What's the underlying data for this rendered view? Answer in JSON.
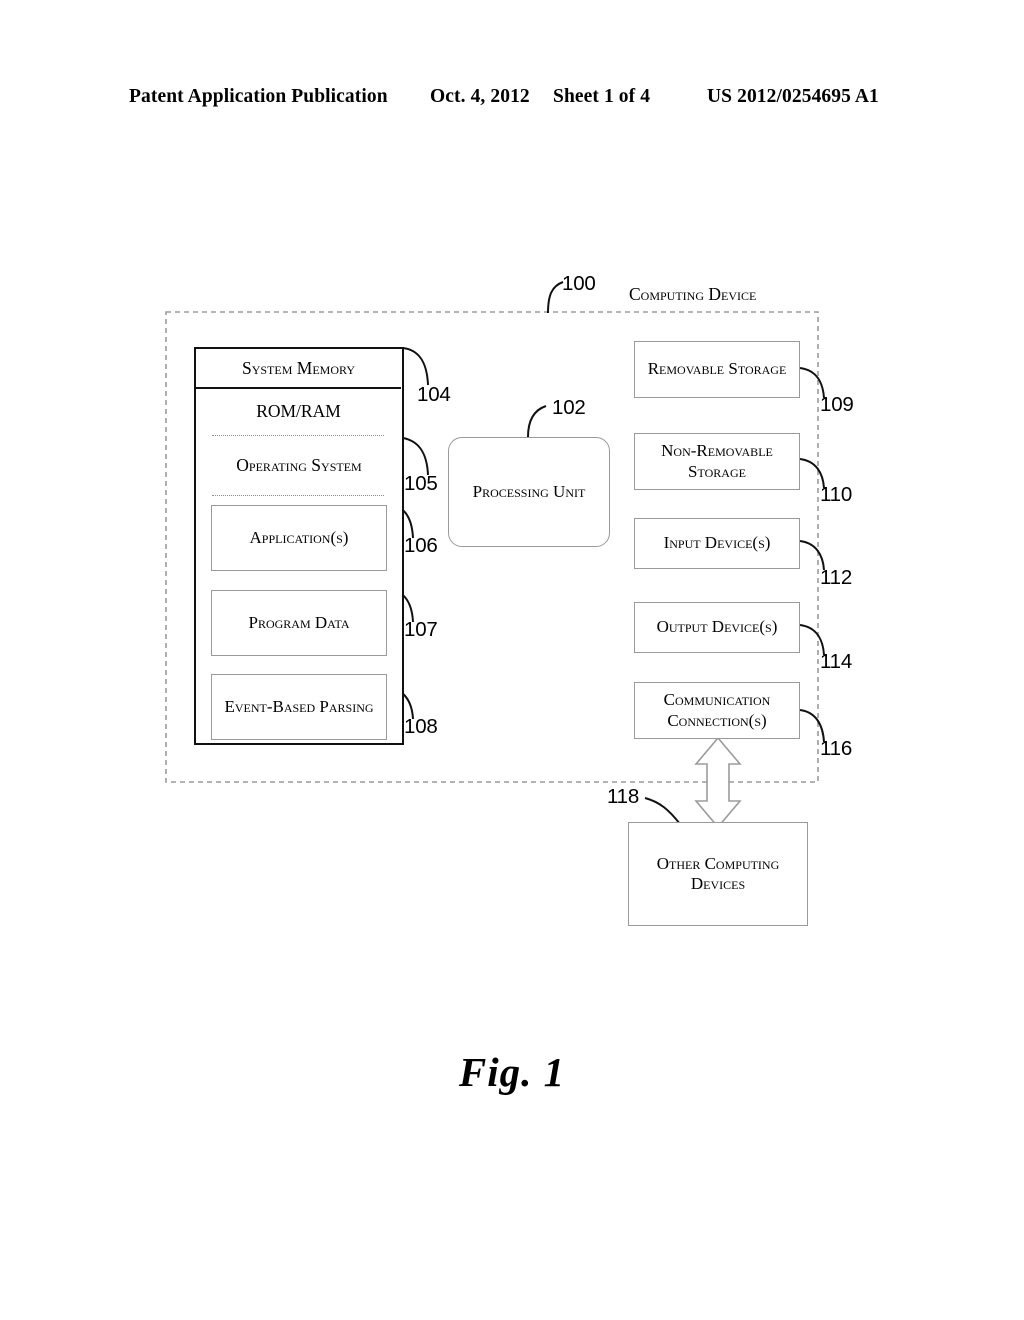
{
  "header": {
    "publication": "Patent Application Publication",
    "date": "Oct. 4, 2012",
    "sheet": "Sheet 1 of 4",
    "number": "US 2012/0254695 A1"
  },
  "figure": {
    "caption": "Fig. 1",
    "system_label": "Computing Device",
    "system_ref": "100"
  },
  "memory": {
    "title": "System Memory",
    "title_ref": "104",
    "romram": "ROM/RAM",
    "os": "Operating System",
    "os_ref": "105",
    "applications": "Application(s)",
    "applications_ref": "106",
    "program_data": "Program Data",
    "program_data_ref": "107",
    "event_parsing": "Event-Based Parsing",
    "event_parsing_ref": "108"
  },
  "processing": {
    "label": "Processing Unit",
    "ref": "102"
  },
  "peripherals": [
    {
      "label": "Removable Storage",
      "ref": "109"
    },
    {
      "label": "Non-Removable Storage",
      "ref": "110"
    },
    {
      "label": "Input Device(s)",
      "ref": "112"
    },
    {
      "label": "Output Device(s)",
      "ref": "114"
    },
    {
      "label": "Communication Connection(s)",
      "ref": "116"
    }
  ],
  "external": {
    "label": "Other Computing Devices",
    "ref": "118"
  }
}
